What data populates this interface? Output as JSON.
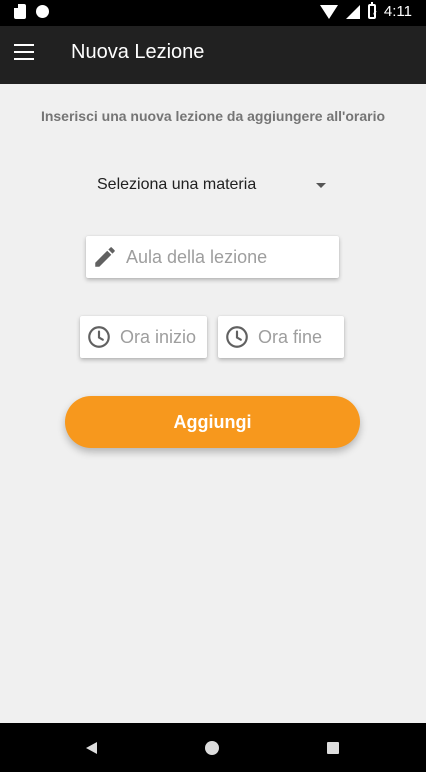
{
  "status_bar": {
    "time": "4:11",
    "left_icons": [
      "sd-card-icon",
      "circle-icon"
    ],
    "right_icons": [
      "wifi-icon",
      "signal-icon",
      "battery-icon"
    ]
  },
  "app_bar": {
    "title": "Nuova Lezione",
    "menu_icon": "menu-icon"
  },
  "form": {
    "subtitle": "Inserisci una nuova lezione da aggiungere all'orario",
    "subject_select": {
      "selected": "Seleziona una materia"
    },
    "room_input": {
      "placeholder": "Aula della lezione",
      "value": "",
      "icon": "pencil-icon"
    },
    "start_time_input": {
      "placeholder": "Ora inizio",
      "value": "",
      "icon": "clock-icon"
    },
    "end_time_input": {
      "placeholder": "Ora fine",
      "value": "",
      "icon": "clock-icon"
    },
    "submit_label": "Aggiungi"
  },
  "colors": {
    "accent": "#f7981d",
    "app_bar": "#212121",
    "background": "#f0f0f0"
  },
  "nav_bar": {
    "buttons": [
      "back-icon",
      "home-icon",
      "recents-icon"
    ]
  }
}
